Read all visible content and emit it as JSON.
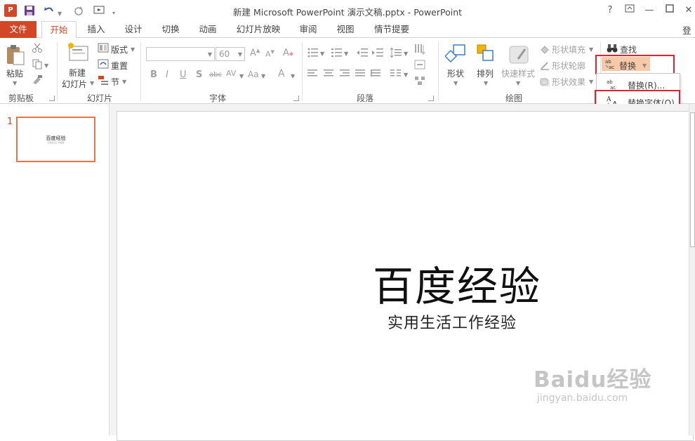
{
  "app": {
    "title": "新建 Microsoft PowerPoint 演示文稿.pptx - PowerPoint",
    "app_icon_letter": "P",
    "help": "?",
    "login": "登录"
  },
  "tabs": [
    {
      "label": "文件"
    },
    {
      "label": "开始"
    },
    {
      "label": "插入"
    },
    {
      "label": "设计"
    },
    {
      "label": "切换"
    },
    {
      "label": "动画"
    },
    {
      "label": "幻灯片放映"
    },
    {
      "label": "审阅"
    },
    {
      "label": "视图"
    },
    {
      "label": "情节提要"
    }
  ],
  "ribbon": {
    "clipboard": {
      "paste": "粘贴",
      "group": "剪贴板"
    },
    "slides": {
      "new_slide_line1": "新建",
      "new_slide_line2": "幻灯片",
      "layout": "版式",
      "reset": "重置",
      "section": "节",
      "group": "幻灯片"
    },
    "font": {
      "font_name": "",
      "font_size": "60",
      "group": "字体"
    },
    "paragraph": {
      "group": "段落"
    },
    "drawing": {
      "shapes": "形状",
      "arrange": "排列",
      "quick_styles": "快速样式",
      "shape_fill": "形状填充",
      "shape_outline": "形状轮廓",
      "shape_effects": "形状效果",
      "group": "绘图"
    },
    "editing": {
      "find": "查找",
      "replace": "替换"
    }
  },
  "replace_menu": {
    "items": [
      {
        "label": "替换(R)..."
      },
      {
        "label": "替换字体(O)..."
      }
    ]
  },
  "slides_pane": {
    "slide_number": "1",
    "thumb_title": "百度经验",
    "thumb_subtitle": "实用生活工作经验"
  },
  "slide": {
    "title": "百度经验",
    "subtitle": "实用生活工作经验"
  },
  "watermark": {
    "brand": "Baidu经验",
    "url": "jingyan.baidu.com"
  },
  "colors": {
    "accent": "#d24726",
    "highlight": "#f7c9a7",
    "annotation_red": "#e0212e"
  }
}
